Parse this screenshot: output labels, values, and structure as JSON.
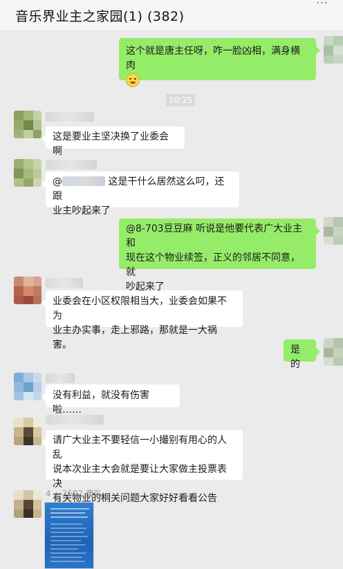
{
  "header": {
    "title": "音乐界业主之家园(1) (382)",
    "menu_icon": "more-icon"
  },
  "timestamp": "10:25",
  "messages": [
    {
      "side": "right",
      "text": "这个就是唐主任呀，咋一脸凶相，满身横肉",
      "emoji": "angry-face-emoji"
    },
    {
      "side": "left",
      "text": "这是要业主坚决换了业委会啊"
    },
    {
      "side": "left",
      "mention_prefix": "@",
      "mention_suffix": "这是干什么居然这么叼，还跟",
      "line2": "业主吵起来了"
    },
    {
      "side": "right",
      "lines": [
        "@8-703豆豆麻 听说是他要代表广大业主和",
        "现在这个物业续签，正义的邻居不同意，就",
        "吵起来了"
      ]
    },
    {
      "side": "left",
      "lines": [
        "业委会在小区权限相当大，业委会如果不为",
        "业主办实事，走上邪路，那就是一大祸害。"
      ]
    },
    {
      "side": "right",
      "text": "是的"
    },
    {
      "side": "left",
      "text": "没有利益，就没有伤害啦……"
    },
    {
      "side": "left",
      "lines": [
        "请广大业主不要轻信一小撮别有用心的人乱",
        "说本次业主大会就是要让大家做主投票表决",
        "有关物业的桐关问题大家好好看看公告"
      ]
    },
    {
      "side": "left",
      "sender": "4 一2602 唐弘",
      "type": "image"
    }
  ],
  "colors": {
    "background": "#ebebeb",
    "own_bubble": "#95ec69",
    "other_bubble": "#ffffff"
  }
}
